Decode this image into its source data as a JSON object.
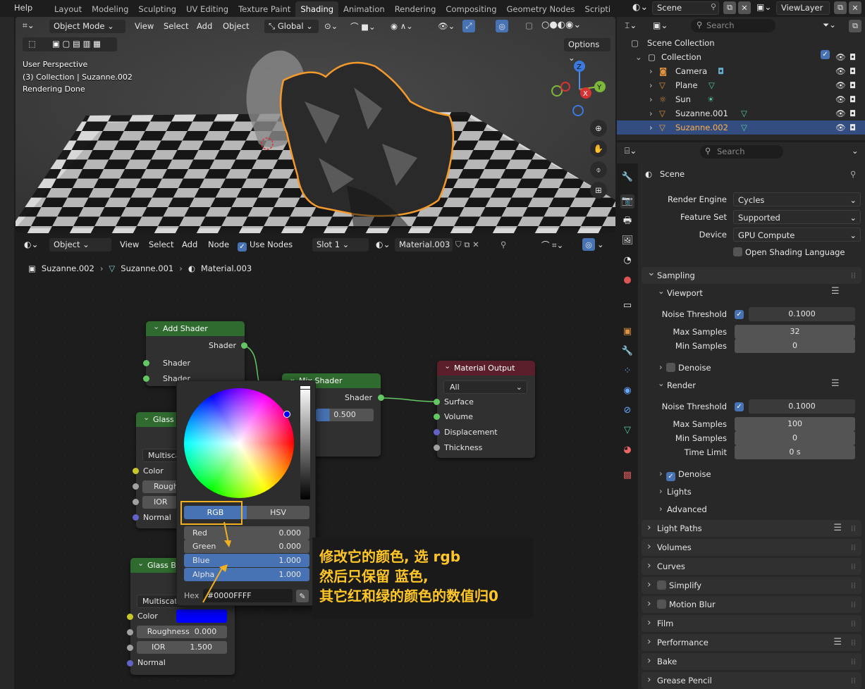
{
  "menubar": {
    "help": "Help",
    "workspaces": [
      "Layout",
      "Modeling",
      "Sculpting",
      "UV Editing",
      "Texture Paint",
      "Shading",
      "Animation",
      "Rendering",
      "Compositing",
      "Geometry Nodes",
      "Scripti"
    ],
    "active_workspace": "Shading",
    "scene": "Scene",
    "view_layer": "ViewLayer"
  },
  "viewport": {
    "mode": "Object Mode",
    "menus": [
      "View",
      "Select",
      "Add",
      "Object"
    ],
    "transform": "Global",
    "options": "Options",
    "overlay_lines": [
      "User Perspective",
      "(3) Collection | Suzanne.002",
      "Rendering Done"
    ],
    "gizmo": {
      "z": "Z",
      "y": "Y",
      "x": "X"
    }
  },
  "node_editor": {
    "type": "Object",
    "menus": [
      "View",
      "Select",
      "Add",
      "Node"
    ],
    "use_nodes": "Use Nodes",
    "slot": "Slot 1",
    "material": "Material.003",
    "breadcrumb": [
      "Suzanne.002",
      "Suzanne.001",
      "Material.003"
    ],
    "nodes": {
      "add_shader": {
        "title": "Add Shader",
        "out": "Shader",
        "in1": "Shader",
        "in2": "Shader"
      },
      "mix_shader": {
        "title": "Mix Shader",
        "out": "Shader",
        "fac": "0.500"
      },
      "material_output": {
        "title": "Material Output",
        "target": "All",
        "inputs": [
          "Surface",
          "Volume",
          "Displacement",
          "Thickness"
        ]
      },
      "glass1": {
        "title": "Glass",
        "dist": "Multisca",
        "color": "Color",
        "rough": "Rough",
        "ior": "IOR",
        "normal": "Normal"
      },
      "glass2": {
        "title": "Glass B",
        "dist": "Multiscat",
        "color": "Color",
        "roughness": "Roughness",
        "roughness_val": "0.000",
        "ior": "IOR",
        "ior_val": "1.500",
        "normal": "Normal"
      }
    },
    "picker": {
      "tabs": [
        "RGB",
        "HSV"
      ],
      "rows": [
        {
          "label": "Red",
          "value": "0.000"
        },
        {
          "label": "Green",
          "value": "0.000"
        },
        {
          "label": "Blue",
          "value": "1.000"
        },
        {
          "label": "Alpha",
          "value": "1.000"
        }
      ],
      "hex_label": "Hex",
      "hex_value": "#0000FFFF"
    },
    "annotation": [
      "修改它的颜色, 选 rgb",
      "然后只保留 蓝色,",
      "其它红和绿的颜色的数值归0"
    ]
  },
  "outliner": {
    "search_placeholder": "Search",
    "root": "Scene Collection",
    "collection": "Collection",
    "items": [
      {
        "name": "Camera",
        "color": "#e0913d"
      },
      {
        "name": "Plane",
        "color": "#e0913d"
      },
      {
        "name": "Sun",
        "color": "#e0913d"
      },
      {
        "name": "Suzanne.001",
        "color": "#e0913d"
      },
      {
        "name": "Suzanne.002",
        "color": "#f0a044"
      }
    ]
  },
  "properties": {
    "search_placeholder": "Search",
    "context": "Scene",
    "render_engine_label": "Render Engine",
    "render_engine": "Cycles",
    "feature_set_label": "Feature Set",
    "feature_set": "Supported",
    "device_label": "Device",
    "device": "GPU Compute",
    "osl": "Open Shading Language",
    "sampling": "Sampling",
    "viewport": "Viewport",
    "vp_noise_label": "Noise Threshold",
    "vp_noise": "0.1000",
    "vp_max_label": "Max Samples",
    "vp_max": "32",
    "vp_min_label": "Min Samples",
    "vp_min": "0",
    "denoise": "Denoise",
    "render": "Render",
    "r_noise_label": "Noise Threshold",
    "r_noise": "0.1000",
    "r_max_label": "Max Samples",
    "r_max": "100",
    "r_min_label": "Min Samples",
    "r_min": "0",
    "time_limit_label": "Time Limit",
    "time_limit": "0 s",
    "denoise2": "Denoise",
    "lights": "Lights",
    "advanced": "Advanced",
    "panels": [
      "Light Paths",
      "Volumes",
      "Curves",
      "Simplify",
      "Motion Blur",
      "Film",
      "Performance",
      "Bake",
      "Grease Pencil"
    ]
  }
}
